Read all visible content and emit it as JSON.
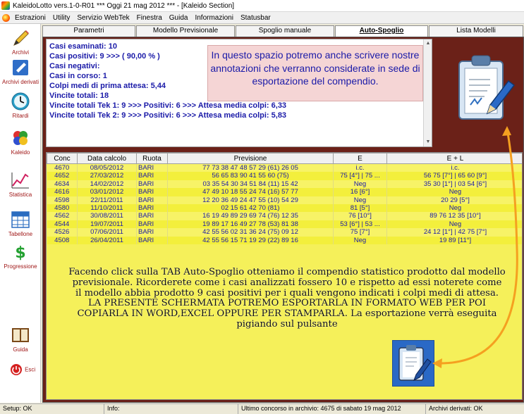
{
  "window": {
    "title": "KaleidoLotto vers.1-0-R01   ***  Oggi 21 mag 2012   ***  - [Kaleido Section]"
  },
  "menu": [
    "Estrazioni",
    "Utility",
    "Servizio WebTek",
    "Finestra",
    "Guida",
    "Informazioni",
    "Statusbar"
  ],
  "sidebar": {
    "items": [
      {
        "label": "Archivi",
        "icon": "pencil-icon"
      },
      {
        "label": "Archivi derivati",
        "icon": "archive-icon"
      },
      {
        "label": "Ritardi",
        "icon": "clock-icon"
      },
      {
        "label": "Kaleido",
        "icon": "kaleido-icon"
      },
      {
        "label": "Statistica",
        "icon": "chart-icon"
      },
      {
        "label": "Tabellone",
        "icon": "table-icon"
      },
      {
        "label": "Progressione",
        "icon": "dollar-icon"
      },
      {
        "label": "Guida",
        "icon": "book-icon"
      },
      {
        "label": "Esci",
        "icon": "exit-icon"
      }
    ]
  },
  "tabs": [
    "Parametri",
    "Modello Previsionale",
    "Spoglio manuale",
    "Auto-Spoglio",
    "Lista Modelli"
  ],
  "active_tab": "Auto-Spoglio",
  "stats": [
    "Casi esaminati: 10",
    "Casi positivi: 9 >>> ( 90,00 % )",
    "Casi negativi:",
    "Casi in corso: 1",
    "Colpi medi di prima attesa: 5,44",
    "Vincite totali: 18",
    "Vincite totali Tek 1: 9 >>> Positivi: 6 >>> Attesa media colpi: 6,33",
    "Vincite totali Tek 2: 9 >>> Positivi: 6 >>> Attesa media colpi: 5,83"
  ],
  "note": "In questo spazio potremo anche scrivere nostre annotazioni che verranno considerate in sede di esportazione del compendio.",
  "table": {
    "headers": [
      "Conc",
      "Data calcolo",
      "Ruota",
      "Previsione",
      "E",
      "E + L"
    ],
    "rows": [
      [
        "4670",
        "08/05/2012",
        "BARI",
        "77 73 38 47 48 57 29 (61) 26 05",
        "i.c.",
        "i.c."
      ],
      [
        "4652",
        "27/03/2012",
        "BARI",
        "56 65 83 90 41 55 60 (75)",
        "75 [4°] | 75 ...",
        "56 75 [7°] | 65 60 [9°]"
      ],
      [
        "4634",
        "14/02/2012",
        "BARI",
        "03 35 54 30 34 51 84 (11) 15 42",
        "Neg",
        "35 30 [1°] | 03 54 [6°]"
      ],
      [
        "4616",
        "03/01/2012",
        "BARI",
        "47 49 10 18 55 24 74 (16) 57 77",
        "16 [6°]",
        "Neg"
      ],
      [
        "4598",
        "22/11/2011",
        "BARI",
        "12 20 36 49 24 47 55 (10) 54 29",
        "Neg",
        "20 29 [5°]"
      ],
      [
        "4580",
        "11/10/2011",
        "BARI",
        "02 15 61 42 70 (81)",
        "81 [5°]",
        "Neg"
      ],
      [
        "4562",
        "30/08/2011",
        "BARI",
        "16 19 49 89 29 69 74 (76) 12 35",
        "76 [10°]",
        "89 76 12 35 [10°]"
      ],
      [
        "4544",
        "19/07/2011",
        "BARI",
        "19 89 17 16 49 27 78 (53) 81 38",
        "53 [6°] | 53 ...",
        "Neg"
      ],
      [
        "4526",
        "07/06/2011",
        "BARI",
        "42 55 56 02 31 36 24 (75) 09 12",
        "75 [7°]",
        "24 12 [1°] | 42 75 [7°]"
      ],
      [
        "4508",
        "26/04/2011",
        "BARI",
        "42 55 56 15 71 19 29 (22) 89 16",
        "Neg",
        "19 89 [11°]"
      ]
    ]
  },
  "annotation": "Facendo click sulla TAB Auto-Spoglio otteniamo il compendio statistico prodotto dal modello previsionale. Ricorderete come i casi analizzati fossero 10 e rispetto ad essi noterete come il modello abbia prodotto 9 casi positivi per i quali vengono indicati i colpi medi di attesa. LA PRESENTE SCHERMATA POTREMO ESPORTARLA IN FORMATO WEB PER POI COPIARLA IN WORD,EXCEL OPPURE PER STAMPARLA. La esportazione verrà eseguita pigiando sul pulsante",
  "status": {
    "setup": "Setup: OK",
    "info": "Info:",
    "last": "Ultimo concorso in archivio: 4675 di sabato 19 mag 2012",
    "derived": "Archivi derivati: OK"
  },
  "colors": {
    "main_bg": "#6b2118",
    "grid_bg": "#f5f05a",
    "stats_text": "#1a1aa8",
    "note_bg": "#f5d5d5",
    "arrow": "#f5a020"
  }
}
